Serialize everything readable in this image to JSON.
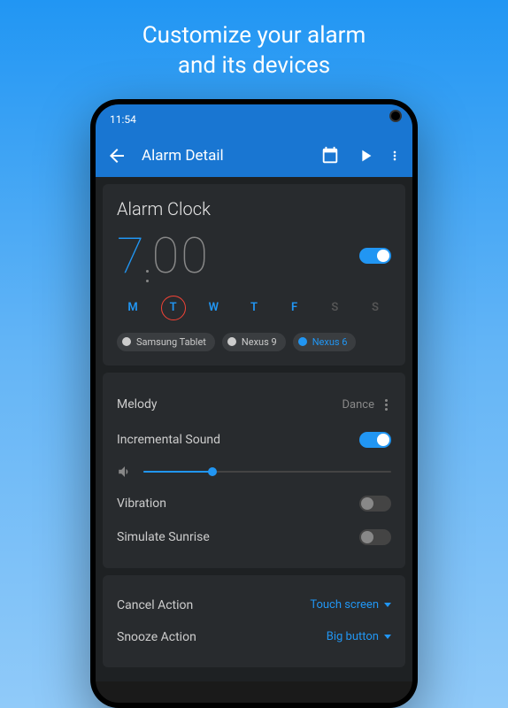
{
  "promo": {
    "line1": "Customize your alarm",
    "line2": "and its devices"
  },
  "statusBar": {
    "time": "11:54"
  },
  "appBar": {
    "title": "Alarm Detail"
  },
  "alarm": {
    "name": "Alarm Clock",
    "hour": "7",
    "minute": "00",
    "enabled": true
  },
  "days": [
    {
      "label": "M",
      "active": true,
      "selected": false
    },
    {
      "label": "T",
      "active": true,
      "selected": true
    },
    {
      "label": "W",
      "active": true,
      "selected": false
    },
    {
      "label": "T",
      "active": true,
      "selected": false
    },
    {
      "label": "F",
      "active": true,
      "selected": false
    },
    {
      "label": "S",
      "active": false,
      "selected": false
    },
    {
      "label": "S",
      "active": false,
      "selected": false
    }
  ],
  "devices": [
    {
      "name": "Samsung Tablet",
      "active": false
    },
    {
      "name": "Nexus 9",
      "active": false
    },
    {
      "name": "Nexus 6",
      "active": true
    }
  ],
  "settings": {
    "melody": {
      "label": "Melody",
      "value": "Dance"
    },
    "incrementalSound": {
      "label": "Incremental Sound",
      "enabled": true
    },
    "volumePercent": 28,
    "vibration": {
      "label": "Vibration",
      "enabled": false
    },
    "sunrise": {
      "label": "Simulate Sunrise",
      "enabled": false
    },
    "cancelAction": {
      "label": "Cancel Action",
      "value": "Touch screen"
    },
    "snoozeAction": {
      "label": "Snooze Action",
      "value": "Big button"
    }
  }
}
